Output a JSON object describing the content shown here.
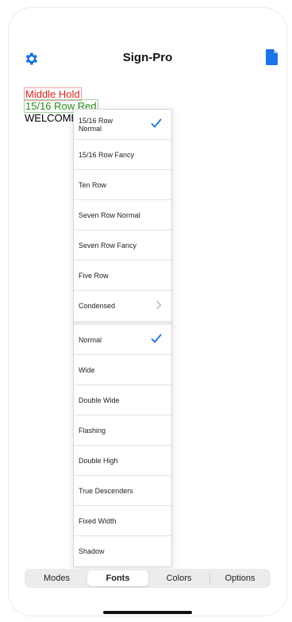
{
  "app": {
    "title": "Sign-Pro"
  },
  "nav": {
    "left_icon": "gear-icon",
    "right_icon": "document-icon"
  },
  "sign": {
    "line1": "Middle Hold",
    "line2": "15/16 Row Red",
    "line3": "WELCOME TO SIGN-PRO"
  },
  "menu": {
    "items": [
      {
        "label": "15/16 Row Normal",
        "checked": true
      },
      {
        "label": "15/16 Row Fancy"
      },
      {
        "label": "Ten Row"
      },
      {
        "label": "Seven Row Normal"
      },
      {
        "label": "Seven Row Fancy"
      },
      {
        "label": "Five Row"
      },
      {
        "label": "Condensed",
        "submenu": true
      },
      {
        "label": "Normal",
        "checked": true
      },
      {
        "label": "Wide"
      },
      {
        "label": "Double Wide"
      },
      {
        "label": "Flashing"
      },
      {
        "label": "Double High"
      },
      {
        "label": "True Descenders"
      },
      {
        "label": "Fixed Width"
      },
      {
        "label": "Shadow"
      }
    ]
  },
  "tabs": [
    {
      "label": "Modes"
    },
    {
      "label": "Fonts",
      "active": true
    },
    {
      "label": "Colors"
    },
    {
      "label": "Options"
    }
  ],
  "colors": {
    "accent": "#1a73e8",
    "red_text": "#e0251b",
    "green_text": "#2b8a1a"
  }
}
